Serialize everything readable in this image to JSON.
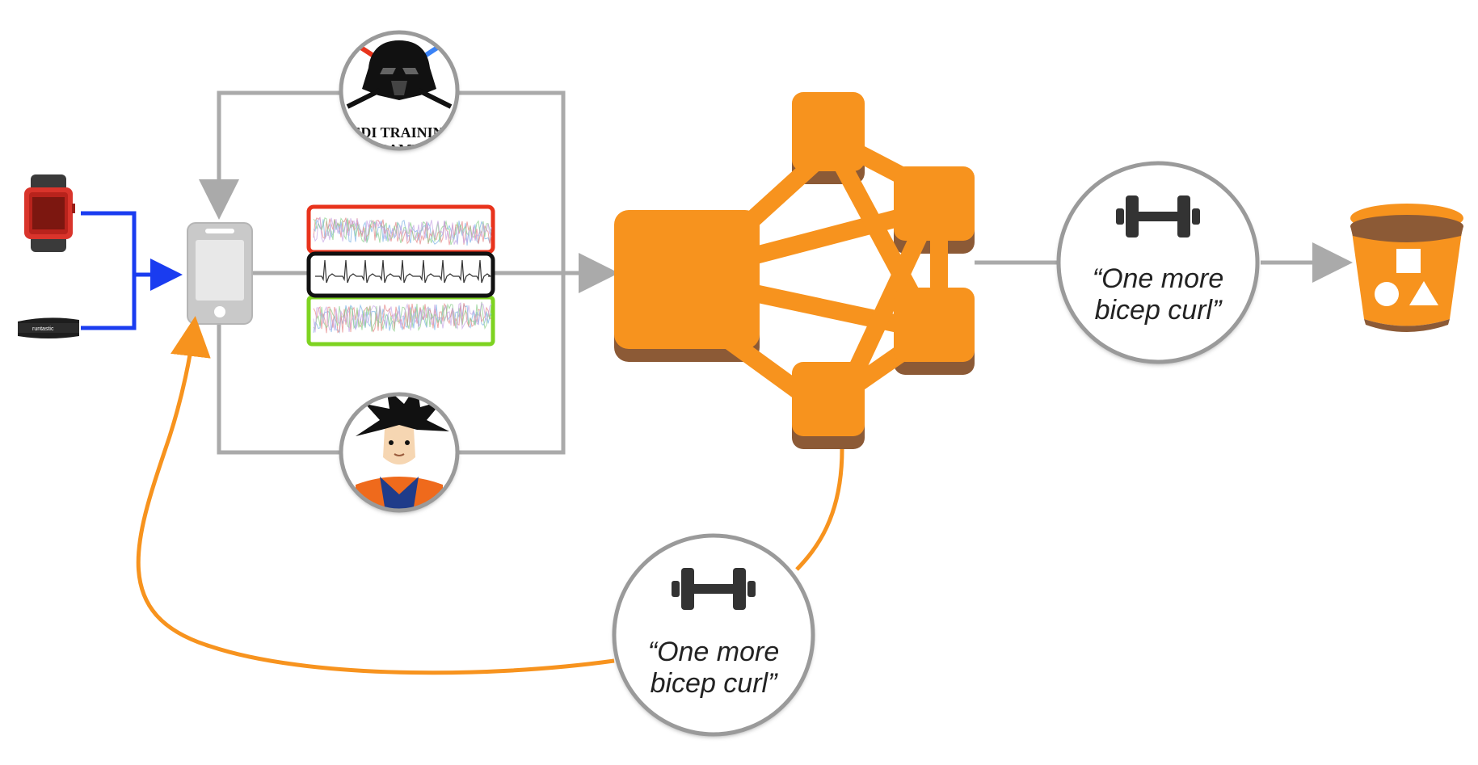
{
  "sources": {
    "smartwatch": {
      "icon": "smartwatch-icon"
    },
    "heart_rate_strap": {
      "icon": "heart-rate-strap-icon",
      "brand": "runtastic"
    }
  },
  "phone": {
    "icon": "smartphone-icon"
  },
  "trainers": {
    "top": {
      "icon": "darth-vader-icon",
      "label_line1": "JEDI TRAINING",
      "label_line2": "CAMP"
    },
    "bottom": {
      "icon": "goku-icon"
    }
  },
  "signals": [
    {
      "name": "signal-red",
      "border_color": "#e8331c"
    },
    {
      "name": "signal-ecg",
      "border_color": "#111111"
    },
    {
      "name": "signal-green",
      "border_color": "#7ed321"
    }
  ],
  "model": {
    "icon": "neural-network-icon",
    "color": "#f7931e",
    "shadow": "#8c5a36"
  },
  "prediction_main": {
    "icon": "dumbbell-icon",
    "line1": "“One more",
    "line2": "bicep curl”"
  },
  "prediction_feedback": {
    "icon": "dumbbell-icon",
    "line1": "“One more",
    "line2": "bicep curl”"
  },
  "storage": {
    "icon": "s3-bucket-icon",
    "color": "#f7931e"
  },
  "colors": {
    "input_arrow": "#1a3cf0",
    "flow_arrow": "#aaaaaa",
    "feedback_arrow": "#f7931e",
    "circle_border": "#9a9a9a"
  }
}
